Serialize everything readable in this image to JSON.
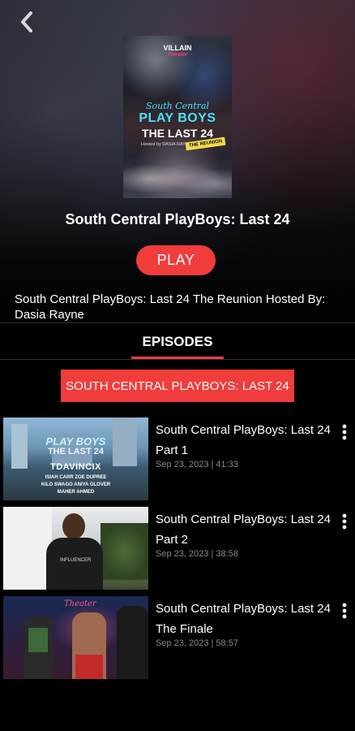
{
  "header": {
    "back_icon": "chevron-left-icon"
  },
  "poster": {
    "venue": "VILLAIN",
    "venue_sub": "Theater",
    "line1": "South Central",
    "line2": "PLAY BOYS",
    "line3": "THE LAST 24",
    "hosted": "Hosted by DASIA RAYNE",
    "badge": "THE REUNION"
  },
  "show": {
    "title": "South Central PlayBoys: Last 24",
    "play_label": "PLAY",
    "description": "South Central PlayBoys: Last 24 The Reunion Hosted By: Dasia Rayne"
  },
  "tabs": {
    "episodes_label": "EPISODES"
  },
  "season": {
    "label": "SOUTH CENTRAL PLAYBOYS: LAST 24"
  },
  "episodes": [
    {
      "title": "South Central PlayBoys: Last 24 Part 1",
      "meta": "Sep 23, 2023 | 41:33",
      "thumb": {
        "line1": "PLAY BOYS",
        "line2": "THE LAST 24",
        "line3": "TDAVINCIX",
        "names1": "ISIAH CARR   ZOE DUPREE",
        "names2": "KILO SWAGO   ANIYA GLOVER",
        "names3": "MAHER AHMED"
      }
    },
    {
      "title": "South Central PlayBoys: Last 24 Part 2",
      "meta": "Sep 23, 2023 | 38:58",
      "thumb": {
        "shirt": "INFLUENCER"
      }
    },
    {
      "title": "South Central PlayBoys: Last 24 The Finale",
      "meta": "Sep 23, 2023 | 58:57",
      "thumb": {
        "neon": "Theater"
      }
    }
  ],
  "colors": {
    "accent": "#f13c3c",
    "background": "#000000",
    "meta_text": "#8a8a8a"
  }
}
